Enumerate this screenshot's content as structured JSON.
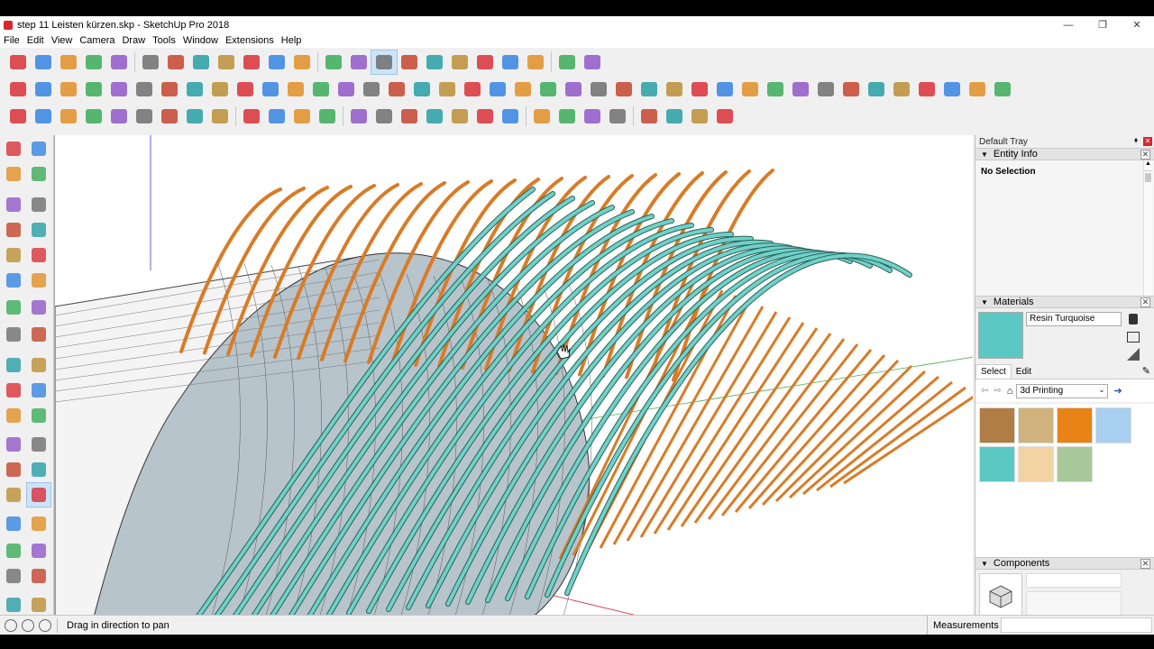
{
  "window": {
    "title": "step 11 Leisten kürzen.skp - SketchUp Pro 2018",
    "controls": [
      "—",
      "❐",
      "✕"
    ]
  },
  "menu": [
    "File",
    "Edit",
    "View",
    "Camera",
    "Draw",
    "Tools",
    "Window",
    "Extensions",
    "Help"
  ],
  "tray": {
    "title": "Default Tray",
    "pin_glyph": "⬧",
    "entity_info": {
      "header": "Entity Info",
      "selection": "No Selection"
    },
    "materials": {
      "header": "Materials",
      "current_name": "Resin Turquoise",
      "tabs": [
        "Select",
        "Edit"
      ],
      "library": "3d Printing",
      "swatches": [
        "#b07d45",
        "#cfb27c",
        "#e88317",
        "#a9cff0",
        "#5cc8c4",
        "#f3d3a4",
        "#a8c89a"
      ],
      "current_color": "#5cc8c4"
    },
    "components": {
      "header": "Components"
    }
  },
  "status": {
    "message": "Drag in direction to pan",
    "measurements_label": "Measurements",
    "measurements_value": ""
  },
  "colors": {
    "accent_selected": "#cde4f7",
    "stick_orange": "#d97b26",
    "stick_teal": "#6fd1c8"
  },
  "icons": {
    "toolbar1": [
      "select-icon",
      "eraser-icon",
      "pencil-icon",
      "arc-icon",
      "rectangle-icon",
      "push-pull-icon",
      "follow-me-icon",
      "move-icon",
      "rotate-icon",
      "scale-icon",
      "tape-measure-icon",
      "text-icon",
      "paint-bucket-icon",
      "orbit-icon",
      "pan-icon",
      "zoom-icon",
      "zoom-extents-icon",
      "warehouse-icon",
      "extension-warehouse-icon",
      "layout-icon",
      "extension-manager-icon",
      "solid-tools-icon",
      "menu-lines-icon"
    ],
    "toolbar2": [
      "s1",
      "s2",
      "s3",
      "s4",
      "s5",
      "s6",
      "s7",
      "s8",
      "s9",
      "s10",
      "s11",
      "s12",
      "s13",
      "s14",
      "s15",
      "s16",
      "s17",
      "s18",
      "s19",
      "s20",
      "s21",
      "s22",
      "s23",
      "s24",
      "s25",
      "s26",
      "s27",
      "s28",
      "s29",
      "s30",
      "s31",
      "s32",
      "s33",
      "s34",
      "s35",
      "s36",
      "s37",
      "s38",
      "s39",
      "s40"
    ],
    "toolbar3": [
      "t1",
      "t2",
      "t3",
      "t4",
      "t5",
      "t6",
      "t7",
      "t8",
      "t9",
      "t10",
      "t11",
      "t12",
      "t13",
      "t14",
      "t15",
      "t16",
      "t17",
      "t18",
      "t19",
      "t20",
      "t21",
      "t22",
      "t23",
      "t24",
      "t25",
      "t26",
      "t27",
      "t28"
    ]
  }
}
